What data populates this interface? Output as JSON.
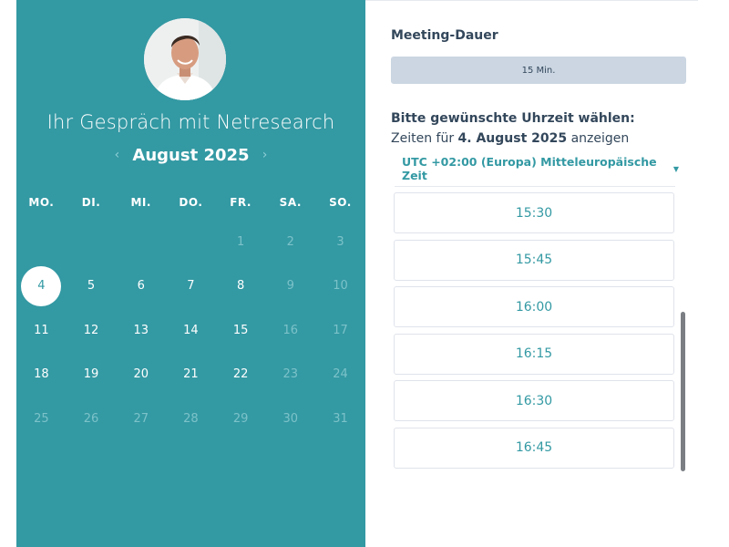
{
  "header": {
    "title": "Ihr Gespräch mit Netresearch",
    "month_label": "August 2025",
    "prev_arrow": "‹",
    "next_arrow": "›"
  },
  "calendar": {
    "weekdays": [
      "MO.",
      "DI.",
      "MI.",
      "DO.",
      "FR.",
      "SA.",
      "SO."
    ],
    "weeks": [
      [
        {
          "label": "",
          "state": "empty"
        },
        {
          "label": "",
          "state": "empty"
        },
        {
          "label": "",
          "state": "empty"
        },
        {
          "label": "",
          "state": "empty"
        },
        {
          "label": "1",
          "state": "disabled"
        },
        {
          "label": "2",
          "state": "disabled"
        },
        {
          "label": "3",
          "state": "disabled"
        }
      ],
      [
        {
          "label": "4",
          "state": "selected"
        },
        {
          "label": "5",
          "state": "active"
        },
        {
          "label": "6",
          "state": "active"
        },
        {
          "label": "7",
          "state": "active"
        },
        {
          "label": "8",
          "state": "active"
        },
        {
          "label": "9",
          "state": "disabled"
        },
        {
          "label": "10",
          "state": "disabled"
        }
      ],
      [
        {
          "label": "11",
          "state": "active"
        },
        {
          "label": "12",
          "state": "active"
        },
        {
          "label": "13",
          "state": "active"
        },
        {
          "label": "14",
          "state": "active"
        },
        {
          "label": "15",
          "state": "active"
        },
        {
          "label": "16",
          "state": "disabled"
        },
        {
          "label": "17",
          "state": "disabled"
        }
      ],
      [
        {
          "label": "18",
          "state": "active"
        },
        {
          "label": "19",
          "state": "active"
        },
        {
          "label": "20",
          "state": "active"
        },
        {
          "label": "21",
          "state": "active"
        },
        {
          "label": "22",
          "state": "active"
        },
        {
          "label": "23",
          "state": "disabled"
        },
        {
          "label": "24",
          "state": "disabled"
        }
      ],
      [
        {
          "label": "25",
          "state": "disabled"
        },
        {
          "label": "26",
          "state": "disabled"
        },
        {
          "label": "27",
          "state": "disabled"
        },
        {
          "label": "28",
          "state": "disabled"
        },
        {
          "label": "29",
          "state": "disabled"
        },
        {
          "label": "30",
          "state": "disabled"
        },
        {
          "label": "31",
          "state": "disabled"
        }
      ]
    ]
  },
  "meeting": {
    "duration_label": "Meeting-Dauer",
    "duration_value": "15 Min."
  },
  "time_selection": {
    "heading": "Bitte gewünschte Uhrzeit wählen:",
    "subtext_prefix": "Zeiten für",
    "subtext_date": "4. August 2025",
    "subtext_suffix": "anzeigen",
    "timezone": "UTC +02:00 (Europa) Mitteleuropäische Zeit",
    "slots": [
      "15:30",
      "15:45",
      "16:00",
      "16:15",
      "16:30",
      "16:45"
    ]
  },
  "colors": {
    "brand_teal": "#3399a3",
    "text_dark": "#33475b",
    "button_grey": "#cbd6e2",
    "scrollbar": "#7b7f84"
  },
  "icons": {
    "avatar": "person-portrait",
    "timezone_caret": "caret-down-icon"
  }
}
